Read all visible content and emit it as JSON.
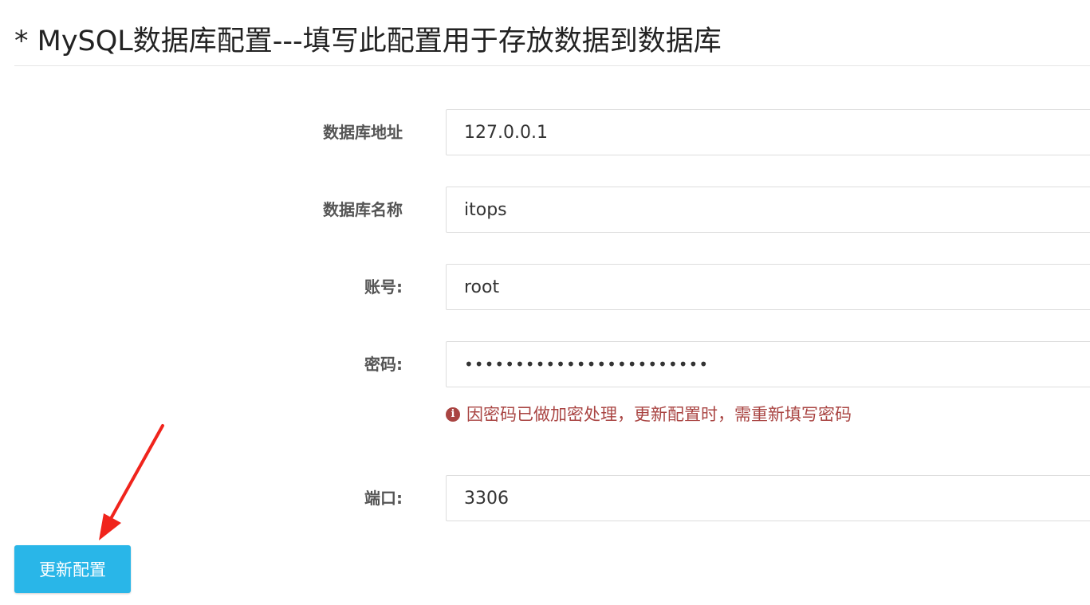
{
  "header": {
    "title": "* MySQL数据库配置---填写此配置用于存放数据到数据库"
  },
  "form": {
    "host": {
      "label": "数据库地址",
      "value": "127.0.0.1"
    },
    "db_name": {
      "label": "数据库名称",
      "value": "itops"
    },
    "account": {
      "label": "账号:",
      "value": "root"
    },
    "password": {
      "label": "密码:",
      "value": "••••••••••••••••••••••••",
      "hint": "因密码已做加密处理，更新配置时，需重新填写密码",
      "hint_icon": "info-circle-icon"
    },
    "port": {
      "label": "端口:",
      "value": "3306"
    }
  },
  "actions": {
    "update_label": "更新配置"
  },
  "colors": {
    "button": "#29b6e8",
    "hint": "#a94442",
    "arrow": "#f0241c"
  }
}
